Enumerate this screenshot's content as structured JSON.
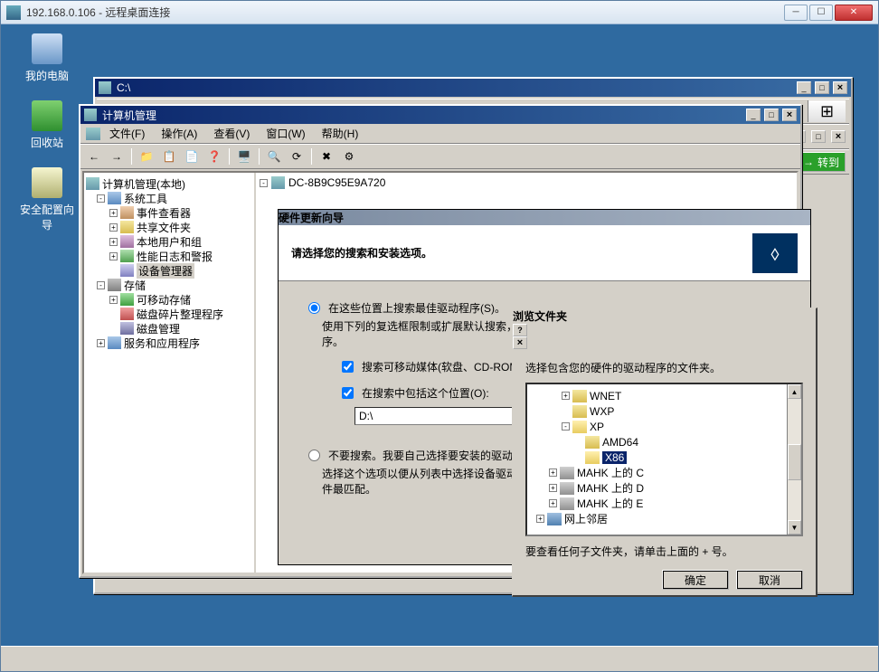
{
  "rdp": {
    "title": "192.168.0.106 - 远程桌面连接"
  },
  "desktop": {
    "mycomputer": "我的电脑",
    "recycle": "回收站",
    "secwiz_l1": "安全配置向",
    "secwiz_l2": "导"
  },
  "explorer": {
    "title": "C:\\",
    "goto": "转到"
  },
  "mmc": {
    "title": "计算机管理",
    "menu": {
      "file": "文件(F)",
      "action": "操作(A)",
      "view": "查看(V)",
      "window": "窗口(W)",
      "help": "帮助(H)"
    },
    "tree": {
      "root": "计算机管理(本地)",
      "systools": "系统工具",
      "event": "事件查看器",
      "shared": "共享文件夹",
      "users": "本地用户和组",
      "perf": "性能日志和警报",
      "device": "设备管理器",
      "storage": "存储",
      "remov": "可移动存储",
      "defrag": "磁盘碎片整理程序",
      "disk": "磁盘管理",
      "services": "服务和应用程序"
    },
    "right_host": "DC-8B9C95E9A720"
  },
  "wizard": {
    "band": "硬件更新向导",
    "heading": "请选择您的搜索和安装选项。",
    "opt1": "在这些位置上搜索最佳驱动程序(S)。",
    "opt1_desc": "使用下列的复选框限制或扩展默认搜索，包括本机路径和可移动媒体。会安装找到的最佳驱动程序。",
    "chk1": "搜索可移动媒体(软盘、CD-ROM...)(M)",
    "chk2": "在搜索中包括这个位置(O):",
    "path": "D:\\",
    "opt2": "不要搜索。我要自己选择要安装的驱动程序(D)。",
    "opt2_desc": "选择这个选项以便从列表中选择设备驱动程序。Windows 不能保证您所选择的驱动程序与您的硬件最匹配。"
  },
  "browse": {
    "title": "浏览文件夹",
    "instruction": "选择包含您的硬件的驱动程序的文件夹。",
    "nodes": {
      "wnet": "WNET",
      "wxp": "WXP",
      "xp": "XP",
      "amd64": "AMD64",
      "x86": "X86",
      "mahk_c": "MAHK 上的 C",
      "mahk_d": "MAHK 上的 D",
      "mahk_e": "MAHK 上的 E",
      "netnb": "网上邻居"
    },
    "hint": "要查看任何子文件夹，请单击上面的 + 号。",
    "ok": "确定",
    "cancel": "取消"
  }
}
